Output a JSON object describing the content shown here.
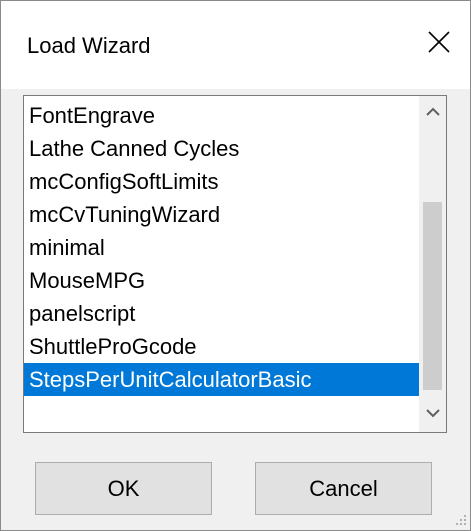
{
  "window": {
    "title": "Load Wizard"
  },
  "list": {
    "items": [
      "FontEngrave",
      "Lathe Canned Cycles",
      "mcConfigSoftLimits",
      "mcCvTuningWizard",
      "minimal",
      "MouseMPG",
      "panelscript",
      "ShuttleProGcode",
      "StepsPerUnitCalculatorBasic"
    ],
    "selected_index": 8
  },
  "buttons": {
    "ok_label": "OK",
    "cancel_label": "Cancel"
  },
  "icons": {
    "close": "close-icon",
    "scroll_up": "chevron-up-icon",
    "scroll_down": "chevron-down-icon",
    "resize": "resize-grip-icon"
  },
  "colors": {
    "selection": "#0078d7",
    "selection_text": "#ffffff"
  }
}
